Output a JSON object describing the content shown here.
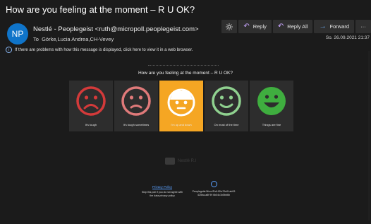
{
  "message": {
    "subject": "How are you feeling at the moment – R U OK?",
    "avatar_initials": "NP",
    "from": "Nestlé - Peoplegeist <ruth@micropoll.peoplegeist.com>",
    "to_label": "To",
    "to": "Görke,Lucia Andrea,CH-Vevey",
    "date": "So. 26.09.2021 21:37"
  },
  "toolbar": {
    "reply_label": "Reply",
    "reply_all_label": "Reply All",
    "forward_label": "Forward",
    "more_label": "···"
  },
  "infobar": {
    "text": "If there are problems with how this message is displayed, click here to view it in a web browser."
  },
  "body": {
    "question": "How are you feeling at the moment – R U OK?",
    "options": [
      {
        "label": "It's tough",
        "color": "#d43a3a"
      },
      {
        "label": "It's tough sometimes",
        "color": "#e07a7a"
      },
      {
        "label": "I'm up and down",
        "color": "#f5a623"
      },
      {
        "label": "On most of the time",
        "color": "#8fd18f"
      },
      {
        "label": "Things are fine",
        "color": "#3fae3f"
      }
    ],
    "watermark": "Nestlé R.I",
    "privacy_link": "Privacy Policy",
    "skip_text": "Skip this poll if you do not agree with the data privacy policy",
    "pp_id": "Peoplegeist.5fccc!Poll:ID!a79c0f-ab93 425ba-a8f 99 6b04c1b5bb6b"
  },
  "colors": {
    "background": "#1b1b1b",
    "accent": "#0f74c9",
    "card": "#2d2d2d"
  }
}
